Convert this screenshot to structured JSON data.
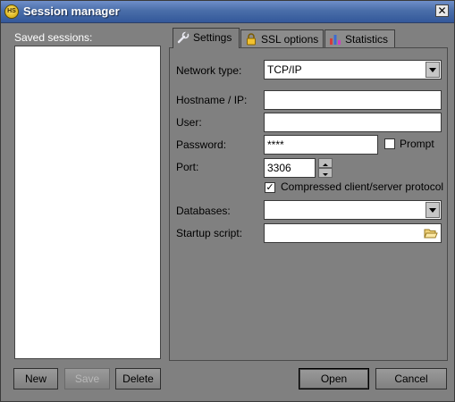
{
  "window": {
    "title": "Session manager",
    "close_symbol": "✕",
    "app_icon_text": "HS"
  },
  "sidebar": {
    "label": "Saved sessions:",
    "sessions": []
  },
  "tabs": [
    {
      "label": "Settings",
      "icon": "wrench-icon",
      "active": true
    },
    {
      "label": "SSL options",
      "icon": "lock-icon",
      "active": false
    },
    {
      "label": "Statistics",
      "icon": "bar-chart-icon",
      "active": false
    }
  ],
  "settings": {
    "network_type": {
      "label": "Network type:",
      "value": "TCP/IP"
    },
    "hostname": {
      "label": "Hostname / IP:",
      "value": ""
    },
    "user": {
      "label": "User:",
      "value": ""
    },
    "password": {
      "label": "Password:",
      "value": "****"
    },
    "prompt": {
      "label": "Prompt",
      "checked": false
    },
    "port": {
      "label": "Port:",
      "value": "3306"
    },
    "compressed": {
      "label": "Compressed client/server protocol",
      "checked": true,
      "check_mark": "✓"
    },
    "databases": {
      "label": "Databases:",
      "value": ""
    },
    "startup_script": {
      "label": "Startup script:",
      "value": ""
    }
  },
  "buttons": {
    "new": "New",
    "save": "Save",
    "delete": "Delete",
    "open": "Open",
    "cancel": "Cancel"
  }
}
